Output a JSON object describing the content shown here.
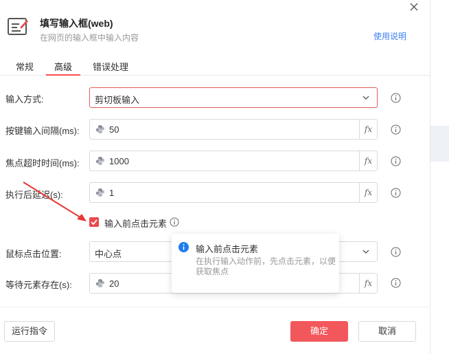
{
  "dialog": {
    "title": "填写输入框(web)",
    "subtitle": "在网页的输入框中输入内容",
    "help_link": "使用说明"
  },
  "tabs": [
    {
      "label": "常规",
      "active": false
    },
    {
      "label": "高级",
      "active": true
    },
    {
      "label": "错误处理",
      "active": false
    }
  ],
  "fields": {
    "input_method": {
      "label": "输入方式:",
      "value": "剪切板输入"
    },
    "key_interval": {
      "label": "按键输入间隔(ms):",
      "value": "50"
    },
    "focus_timeout": {
      "label": "焦点超时时间(ms):",
      "value": "1000"
    },
    "post_delay": {
      "label": "执行后延迟(s):",
      "value": "1"
    },
    "click_position": {
      "label": "鼠标点击位置:",
      "value": "中心点"
    },
    "wait_exists": {
      "label": "等待元素存在(s):",
      "value": "20"
    }
  },
  "fx_label": "fx",
  "checkbox": {
    "label": "输入前点击元素",
    "checked": true
  },
  "popover": {
    "title": "输入前点击元素",
    "description": "在执行输入动作前，先点击元素，以便获取焦点"
  },
  "footer": {
    "run_label": "运行指令",
    "ok_label": "确定",
    "cancel_label": "取消"
  },
  "colors": {
    "accent": "#f2575b",
    "link": "#3d7ff0",
    "info": "#1e7cf0"
  }
}
